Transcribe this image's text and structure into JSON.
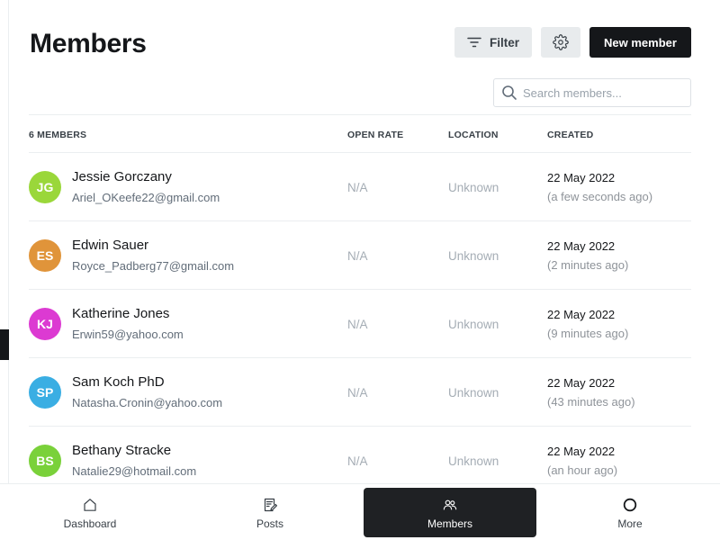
{
  "header": {
    "title": "Members",
    "filter_label": "Filter",
    "new_member_label": "New member"
  },
  "search": {
    "placeholder": "Search members...",
    "value": ""
  },
  "table": {
    "columns": {
      "members": "6 MEMBERS",
      "open_rate": "OPEN RATE",
      "location": "LOCATION",
      "created": "CREATED"
    },
    "rows": [
      {
        "initials": "JG",
        "avatar_color": "#9ad73a",
        "name": "Jessie Gorczany",
        "email": "Ariel_OKeefe22@gmail.com",
        "open_rate": "N/A",
        "location": "Unknown",
        "created_date": "22 May 2022",
        "created_ago": "(a few seconds ago)"
      },
      {
        "initials": "ES",
        "avatar_color": "#e0943a",
        "name": "Edwin Sauer",
        "email": "Royce_Padberg77@gmail.com",
        "open_rate": "N/A",
        "location": "Unknown",
        "created_date": "22 May 2022",
        "created_ago": "(2 minutes ago)"
      },
      {
        "initials": "KJ",
        "avatar_color": "#dc3ad2",
        "name": "Katherine Jones",
        "email": "Erwin59@yahoo.com",
        "open_rate": "N/A",
        "location": "Unknown",
        "created_date": "22 May 2022",
        "created_ago": "(9 minutes ago)"
      },
      {
        "initials": "SP",
        "avatar_color": "#3aaee3",
        "name": "Sam Koch PhD",
        "email": "Natasha.Cronin@yahoo.com",
        "open_rate": "N/A",
        "location": "Unknown",
        "created_date": "22 May 2022",
        "created_ago": "(43 minutes ago)"
      },
      {
        "initials": "BS",
        "avatar_color": "#7ad13a",
        "name": "Bethany Stracke",
        "email": "Natalie29@hotmail.com",
        "open_rate": "N/A",
        "location": "Unknown",
        "created_date": "22 May 2022",
        "created_ago": "(an hour ago)"
      }
    ]
  },
  "bottom_nav": {
    "items": [
      {
        "label": "Dashboard",
        "icon": "home-icon",
        "active": false
      },
      {
        "label": "Posts",
        "icon": "posts-icon",
        "active": false
      },
      {
        "label": "Members",
        "icon": "members-icon",
        "active": true
      },
      {
        "label": "More",
        "icon": "more-icon",
        "active": false
      }
    ]
  },
  "colors": {
    "primary_dark": "#15171a",
    "button_gray": "#e8ebed",
    "muted_text": "#a5adb5",
    "border": "#ebeef0"
  }
}
